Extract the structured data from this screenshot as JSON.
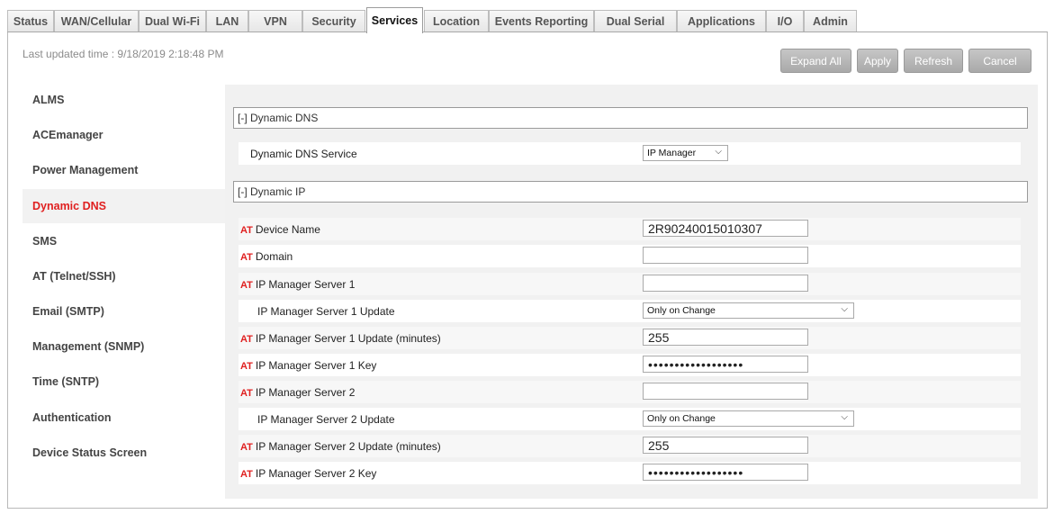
{
  "tabs": [
    {
      "label": "Status"
    },
    {
      "label": "WAN/Cellular"
    },
    {
      "label": "Dual Wi-Fi"
    },
    {
      "label": "LAN"
    },
    {
      "label": "VPN"
    },
    {
      "label": "Security"
    },
    {
      "label": "Services"
    },
    {
      "label": "Location"
    },
    {
      "label": "Events Reporting"
    },
    {
      "label": "Dual Serial"
    },
    {
      "label": "Applications"
    },
    {
      "label": "I/O"
    },
    {
      "label": "Admin"
    }
  ],
  "active_tab": "Services",
  "last_updated": "Last updated time : 9/18/2019 2:18:48 PM",
  "toolbar": {
    "expand_all": "Expand All",
    "apply": "Apply",
    "refresh": "Refresh",
    "cancel": "Cancel"
  },
  "sidebar": {
    "items": [
      {
        "label": "ALMS"
      },
      {
        "label": "ACEmanager"
      },
      {
        "label": "Power Management"
      },
      {
        "label": "Dynamic DNS"
      },
      {
        "label": "SMS"
      },
      {
        "label": "AT (Telnet/SSH)"
      },
      {
        "label": "Email (SMTP)"
      },
      {
        "label": "Management (SNMP)"
      },
      {
        "label": "Time (SNTP)"
      },
      {
        "label": "Authentication"
      },
      {
        "label": "Device Status Screen"
      }
    ],
    "active": "Dynamic DNS"
  },
  "sections": {
    "dynamic_dns": "[-] Dynamic DNS",
    "dynamic_ip": "[-] Dynamic IP"
  },
  "dns_service": {
    "label": "Dynamic DNS Service",
    "value": "IP Manager"
  },
  "at_prefix": "AT",
  "fields": {
    "device_name": {
      "label": "Device Name",
      "value": "2R90240015010307"
    },
    "domain": {
      "label": "Domain",
      "value": ""
    },
    "server1": {
      "label": "IP Manager Server 1",
      "value": ""
    },
    "server1_update": {
      "label": "IP Manager Server 1 Update",
      "value": "Only on Change"
    },
    "server1_update_minutes": {
      "label": "IP Manager Server 1 Update (minutes)",
      "value": "255"
    },
    "server1_key": {
      "label": "IP Manager Server 1 Key",
      "value": "••••••••••••••••••"
    },
    "server2": {
      "label": "IP Manager Server 2",
      "value": ""
    },
    "server2_update": {
      "label": "IP Manager Server 2 Update",
      "value": "Only on Change"
    },
    "server2_update_minutes": {
      "label": "IP Manager Server 2 Update (minutes)",
      "value": "255"
    },
    "server2_key": {
      "label": "IP Manager Server 2 Key",
      "value": "••••••••••••••••••"
    }
  },
  "colors": {
    "accent_red": "#e02020",
    "button_gray": "#b5b5b5",
    "panel_bg": "#f1f1f1"
  }
}
